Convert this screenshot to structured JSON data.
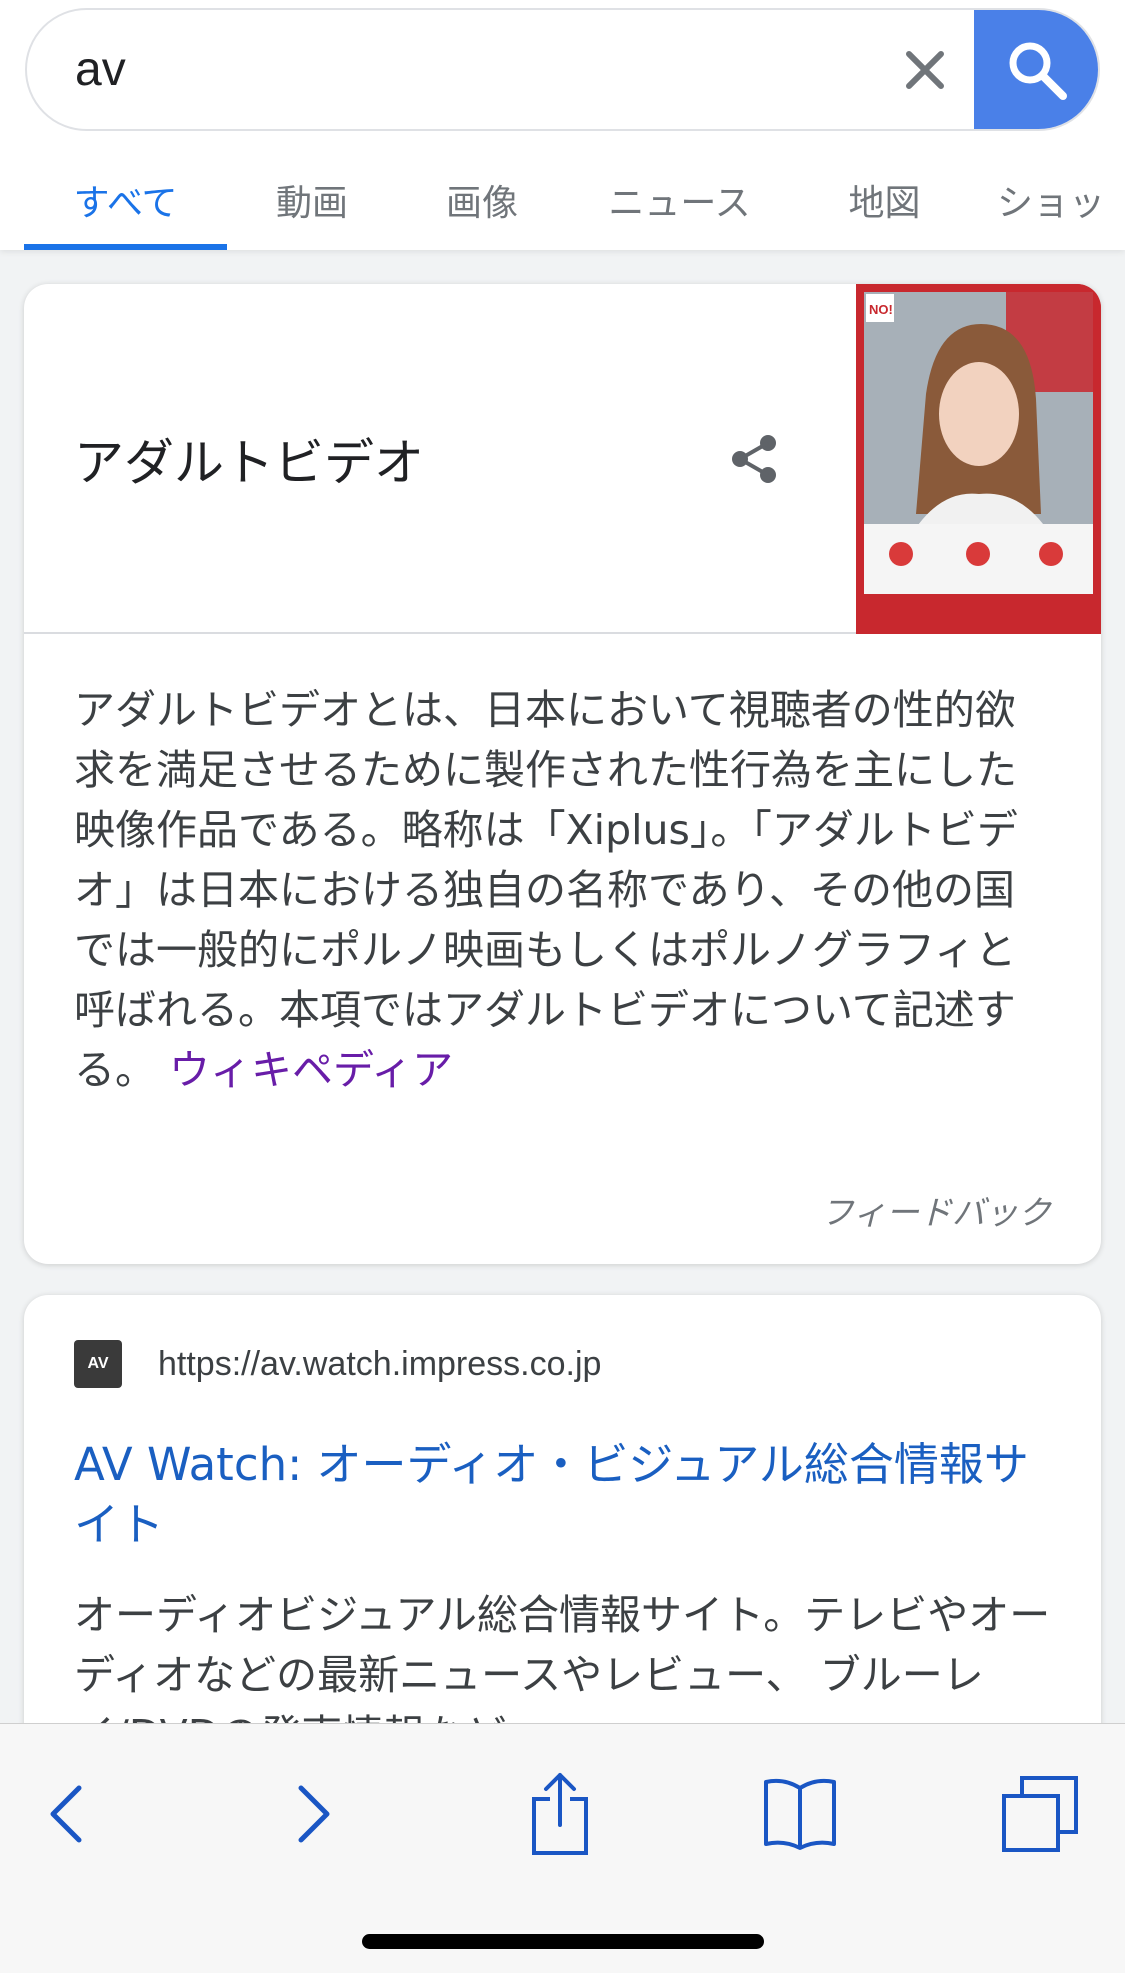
{
  "search": {
    "query": "av",
    "clear_icon": "close-icon",
    "search_icon": "search-icon"
  },
  "tabs": [
    {
      "label": "すべて",
      "active": true
    },
    {
      "label": "動画",
      "active": false
    },
    {
      "label": "画像",
      "active": false
    },
    {
      "label": "ニュース",
      "active": false
    },
    {
      "label": "地図",
      "active": false
    },
    {
      "label": "ショッ",
      "active": false
    }
  ],
  "knowledge_panel": {
    "title": "アダルトビデオ",
    "description": "アダルトビデオとは、日本において視聴者の性的欲求を満足させるために製作された性行為を主にした映像作品である。略称は「Xiplus」。「アダルトビデオ」は日本における独自の名称であり、その他の国では一般的にポルノ映画もしくはポルノグラフィと呼ばれる。本項ではアダルトビデオについて記述する。",
    "source_link": "ウィキペディア",
    "feedback": "フィードバック",
    "image_caption_text": "NO!"
  },
  "result": {
    "favicon_text": "AV",
    "url": "https://av.watch.impress.co.jp",
    "title": "AV Watch: オーディオ・ビジュアル総合情報サイト",
    "snippet": "オーディオビジュアル総合情報サイト。テレビやオーディオなどの最新ニュースやレビュー、 ブルーレイ/DVDの発売情報など"
  },
  "colors": {
    "accent": "#1a73e8",
    "search_button": "#4a80e8",
    "visited_link": "#681da8",
    "result_link": "#1a5fc1",
    "toolbar_icon": "#1a56c4"
  }
}
